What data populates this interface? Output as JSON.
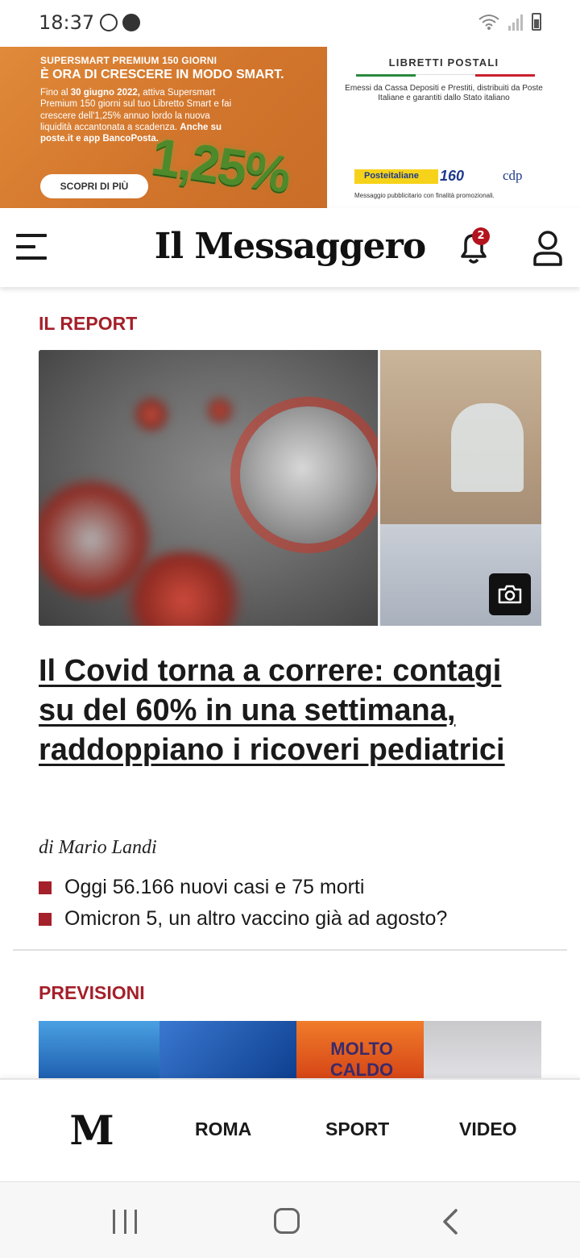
{
  "status_bar": {
    "time": "18:37",
    "icons_left": [
      "whatsapp-icon",
      "notification-icon"
    ],
    "icons_right": [
      "wifi-icon",
      "signal-icon",
      "battery-icon"
    ]
  },
  "ad": {
    "left": {
      "head1": "SUPERSMART PREMIUM 150 GIORNI",
      "head2": "È ORA DI CRESCERE IN MODO SMART.",
      "body_line1": "Fino al ",
      "body_date": "30 giugno 2022,",
      "body_rest": "attiva Supersmart Premium 150 giorni sul tuo Libretto Smart e fai crescere dell'1,25% annuo lordo la nuova liquidità accantonata a scadenza.",
      "body_bold": "Anche su poste.it e app BancoPosta.",
      "cta": "SCOPRI DI PIÙ",
      "rate": "1,25%"
    },
    "right": {
      "title": "LIBRETTI POSTALI",
      "text": "Emessi da Cassa Depositi e Prestiti, distribuiti da Poste Italiane e garantiti dallo Stato italiano",
      "brand_poste": "Posteitaliane",
      "brand_160": "160",
      "brand_cdp": "cdp",
      "disclaimer": "Messaggio pubblicitario con finalità promozionali."
    }
  },
  "header": {
    "logo": "Il Messaggero",
    "notifications_count": "2"
  },
  "sections": {
    "first_label": "IL REPORT",
    "headline": "Il Covid torna a correre: contagi su del 60% in una settimana, raddoppiano i ricoveri pediatrici",
    "author": "di Mario Landi",
    "related": [
      "Oggi 56.166 nuovi casi e 75 morti",
      "Omicron 5, un altro vaccino già ad agosto?"
    ],
    "second_label": "PREVISIONI",
    "thumb_text": "MOLTO CALDO"
  },
  "bottom_nav": {
    "logo": "M",
    "items": [
      "ROMA",
      "SPORT",
      "VIDEO"
    ]
  },
  "colors": {
    "accent_red": "#a4202a",
    "badge_red": "#b3141e",
    "ad_orange": "#d2752c"
  }
}
